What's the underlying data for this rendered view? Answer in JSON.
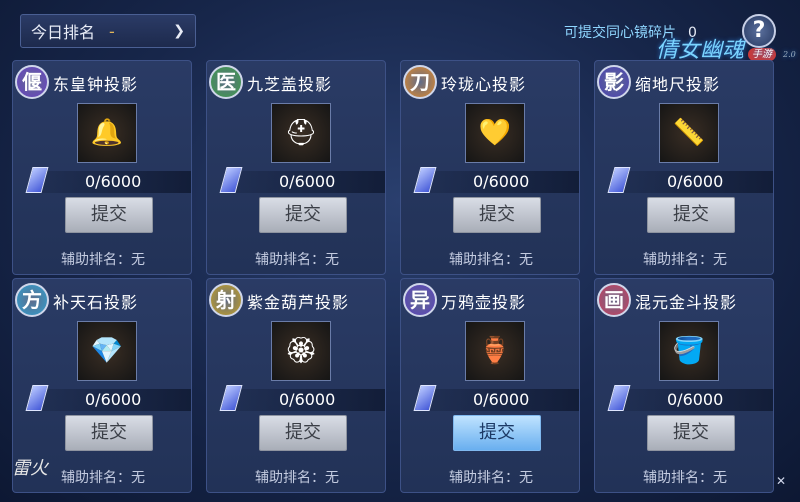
{
  "header": {
    "rank_select_label": "今日排名",
    "rank_select_value": "-",
    "fragments_label": "可提交同心镜碎片",
    "fragments_count": "0",
    "help_label": "?",
    "logo_text": "倩女幽魂",
    "logo_sub": "手游",
    "logo_version": "2.0"
  },
  "cards": [
    {
      "badge": "偃",
      "badge_color": "#6a3fc8",
      "title": "东皇钟投影",
      "art": "🔔",
      "progress": "0/6000",
      "submit": "提交",
      "assist": "辅助排名：无",
      "active": false
    },
    {
      "badge": "医",
      "badge_color": "#3aa043",
      "title": "九芝盖投影",
      "art": "⛑",
      "progress": "0/6000",
      "submit": "提交",
      "assist": "辅助排名：无",
      "active": false
    },
    {
      "badge": "刀",
      "badge_color": "#e0892a",
      "title": "玲珑心投影",
      "art": "💛",
      "progress": "0/6000",
      "submit": "提交",
      "assist": "辅助排名：无",
      "active": false
    },
    {
      "badge": "影",
      "badge_color": "#4b3fb8",
      "title": "缩地尺投影",
      "art": "📏",
      "progress": "0/6000",
      "submit": "提交",
      "assist": "辅助排名：无",
      "active": false
    },
    {
      "badge": "方",
      "badge_color": "#2f9fd0",
      "title": "补天石投影",
      "art": "💎",
      "progress": "0/6000",
      "submit": "提交",
      "assist": "辅助排名：无",
      "active": false
    },
    {
      "badge": "射",
      "badge_color": "#c8a21f",
      "title": "紫金葫芦投影",
      "art": "🏵",
      "progress": "0/6000",
      "submit": "提交",
      "assist": "辅助排名：无",
      "active": false
    },
    {
      "badge": "异",
      "badge_color": "#5b3fc0",
      "title": "万鸦壶投影",
      "art": "🏺",
      "progress": "0/6000",
      "submit": "提交",
      "assist": "辅助排名：无",
      "active": true
    },
    {
      "badge": "画",
      "badge_color": "#d23a5a",
      "title": "混元金斗投影",
      "art": "🪣",
      "progress": "0/6000",
      "submit": "提交",
      "assist": "辅助排名：无",
      "active": false
    }
  ],
  "watermark": "雷火"
}
